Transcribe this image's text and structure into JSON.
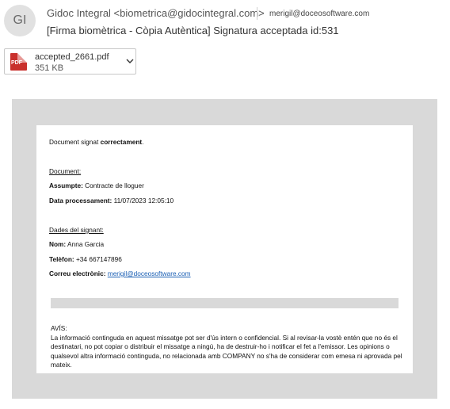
{
  "header": {
    "avatar_initials": "GI",
    "from": "Gidoc Integral <biometrica@gidocintegral.com>",
    "to": "merigil@doceosoftware.com",
    "subject": "[Firma biomètrica - Còpia Autèntica] Signatura acceptada id:531"
  },
  "attachment": {
    "icon": "pdf-icon",
    "icon_text": "PDF",
    "name": "accepted_2661.pdf",
    "size": "351 KB"
  },
  "body": {
    "intro_prefix": "Document signat ",
    "intro_bold": "correctament",
    "intro_suffix": ".",
    "document_heading": "Document:",
    "subject_label": "Assumpte:",
    "subject_value": " Contracte de lloguer",
    "processed_label": "Data processament:",
    "processed_value": " 11/07/2023 12:05:10",
    "signer_heading": "Dades del signant:",
    "name_label": "Nom:",
    "name_value": " Anna Garcia",
    "phone_label": "Telèfon:",
    "phone_value": " +34 667147896",
    "email_label": "Correu electrònic:",
    "email_value": "merigil@doceosoftware.com",
    "notice_title": "AVÍS:",
    "notice_text": "La informació continguda en aquest missatge pot ser d'ús intern o confidencial. Si al revisar-la vostè entén que no és el destinatari, no pot copiar o distribuir el missatge a ningú, ha de destruir-ho i notificar el fet a l'emissor. Les opinions o qualsevol altra informació continguda, no relacionada amb COMPANY no s'ha de considerar com emesa ni aprovada pel mateix."
  }
}
